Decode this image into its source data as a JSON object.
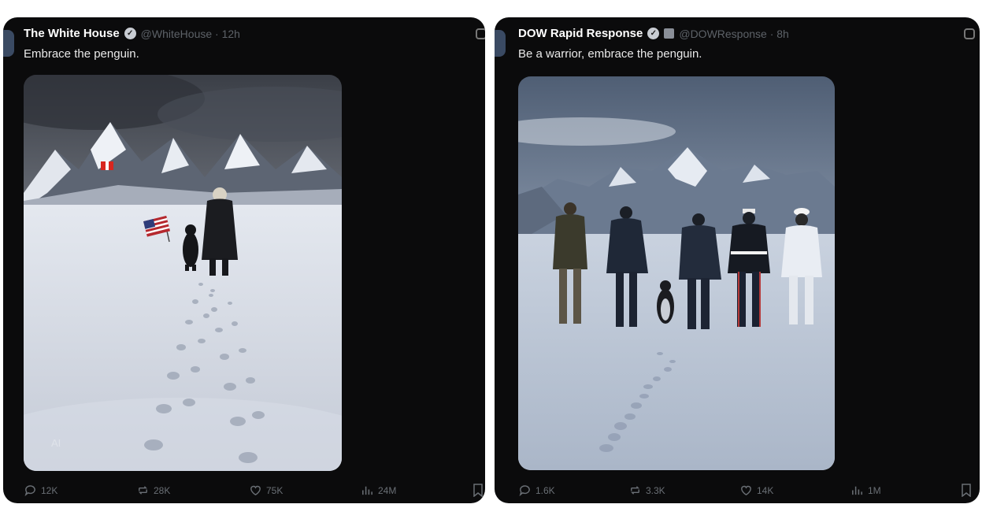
{
  "tweets": [
    {
      "author": "The White House",
      "handle": "@WhiteHouse · 12h",
      "text": "Embrace the penguin.",
      "replies": "12K",
      "reposts": "28K",
      "likes": "75K",
      "views": "24M",
      "watermark": "AI"
    },
    {
      "author": "DOW Rapid Response",
      "handle": "@DOWResponse · 8h",
      "text": "Be a warrior, embrace the penguin.",
      "replies": "1.6K",
      "reposts": "3.3K",
      "likes": "14K",
      "views": "1M"
    }
  ],
  "colors": {
    "background": "#0b0b0c",
    "text": "#e9e9e9",
    "muted": "#5d6268"
  },
  "icons": [
    "verified-icon",
    "government-badge-icon",
    "more-icon",
    "reply-icon",
    "repost-icon",
    "like-icon",
    "views-icon",
    "bookmark-icon"
  ]
}
